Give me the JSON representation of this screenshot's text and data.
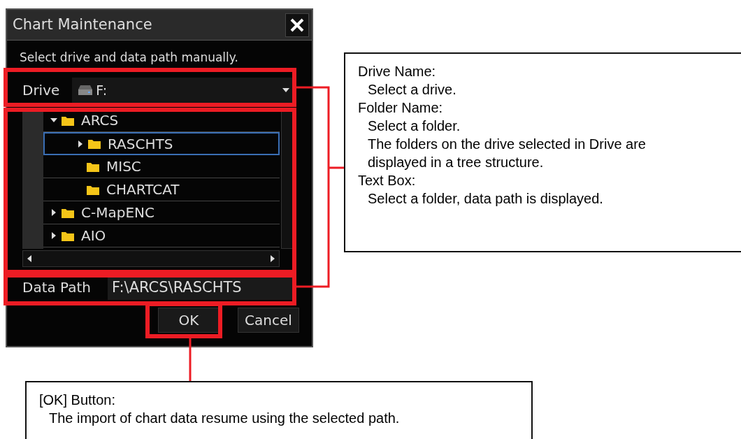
{
  "dialog": {
    "title": "Chart Maintenance",
    "instruction": "Select drive and data path manually.",
    "drive": {
      "label": "Drive",
      "value": "F:"
    },
    "tree": [
      {
        "label": "ARCS",
        "expanded": true,
        "selected": false,
        "children": [
          {
            "label": "RASCHTS",
            "expanded": false,
            "selected": true
          },
          {
            "label": "MISC",
            "selected": false
          },
          {
            "label": "CHARTCAT",
            "selected": false
          }
        ]
      },
      {
        "label": "C-MapENC",
        "expanded": false,
        "selected": false
      },
      {
        "label": "AIO",
        "expanded": false,
        "selected": false
      }
    ],
    "data_path": {
      "label": "Data Path",
      "value": "F:\\ARCS\\RASCHTS"
    },
    "buttons": [
      {
        "label": "OK"
      },
      {
        "label": "Cancel"
      }
    ]
  },
  "callouts": [
    {
      "lines": [
        {
          "kind": "term",
          "text": "Drive Name:"
        },
        {
          "kind": "desc",
          "text": "Select a drive."
        },
        {
          "kind": "term",
          "text": "Folder Name:"
        },
        {
          "kind": "desc",
          "text": "Select a folder."
        },
        {
          "kind": "desc",
          "text": "The folders on the drive selected in Drive are displayed in a tree structure."
        },
        {
          "kind": "term",
          "text": "Text Box:"
        },
        {
          "kind": "desc",
          "text": "Select a folder, data path is displayed."
        }
      ]
    },
    {
      "lines": [
        {
          "kind": "term",
          "text": "[OK] Button:"
        },
        {
          "kind": "desc",
          "text": "The import of chart data resume using the selected path."
        }
      ]
    }
  ]
}
